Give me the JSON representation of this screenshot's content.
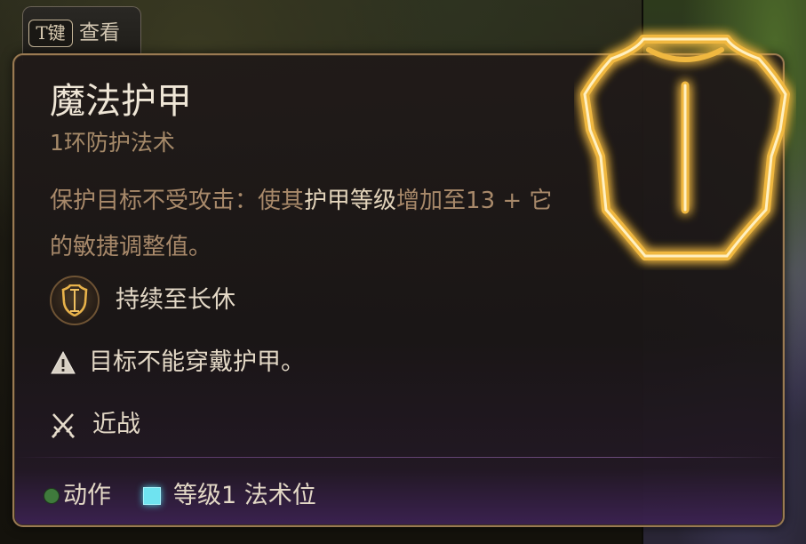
{
  "hint_tab": {
    "key": "T键",
    "label": "查看"
  },
  "spell": {
    "name": "魔法护甲",
    "level_school": "1环防护法术",
    "description": {
      "part1": "保护目标不受攻击：使其",
      "highlight": "护甲等级",
      "part2": "增加至13 + 它的敏捷调整值。"
    },
    "duration": "持续至长休",
    "warning": "目标不能穿戴护甲。",
    "range": "近战"
  },
  "footer": {
    "action_label": "动作",
    "cost_label": "等级1 法术位"
  },
  "colors": {
    "title": "#efe6d6",
    "subtitle": "#a68a69",
    "highlight": "#e3d4bb",
    "panel_border": "#9a7a52",
    "action_dot": "#3f7a3c",
    "spell_slot": "#6fe3f0",
    "emblem_glow": "#f0b840"
  },
  "icons": {
    "emblem": "mage-armor-icon",
    "duration": "duration-icon",
    "warning": "warning-icon",
    "range": "crossed-swords-icon"
  }
}
